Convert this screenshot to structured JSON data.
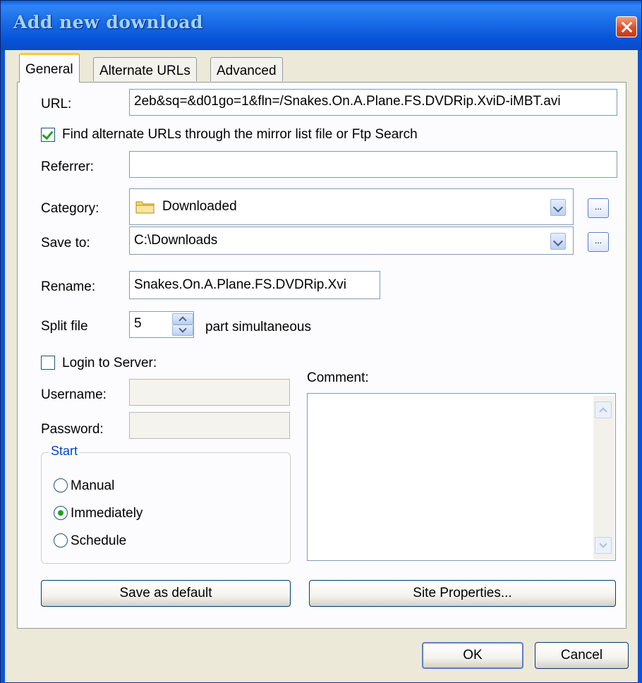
{
  "window": {
    "title": "Add new download"
  },
  "tabs": [
    {
      "label": "General"
    },
    {
      "label": "Alternate URLs"
    },
    {
      "label": "Advanced"
    }
  ],
  "url": {
    "label": "URL:",
    "value": "2eb&sq=&d01go=1&fln=/Snakes.On.A.Plane.FS.DVDRip.XviD-iMBT.avi"
  },
  "find_alternate": {
    "label": "Find alternate URLs through the mirror list file or Ftp Search",
    "checked": true
  },
  "referrer": {
    "label": "Referrer:",
    "value": ""
  },
  "category": {
    "label": "Category:",
    "value": "Downloaded",
    "icon": "folder-icon",
    "browse_label": "..."
  },
  "save_to": {
    "label": "Save to:",
    "value": "C:\\Downloads",
    "browse_label": "..."
  },
  "rename": {
    "label": "Rename:",
    "value": "Snakes.On.A.Plane.FS.DVDRip.Xvi"
  },
  "split": {
    "label": "Split file",
    "value": "5",
    "suffix": "part simultaneous"
  },
  "login": {
    "label": "Login to Server:",
    "checked": false
  },
  "username": {
    "label": "Username:",
    "value": ""
  },
  "password": {
    "label": "Password:",
    "value": ""
  },
  "comment": {
    "label": "Comment:",
    "value": ""
  },
  "start": {
    "title": "Start",
    "options": [
      {
        "label": "Manual",
        "selected": false
      },
      {
        "label": "Immediately",
        "selected": true
      },
      {
        "label": "Schedule",
        "selected": false
      }
    ]
  },
  "buttons": {
    "save_default": "Save as default",
    "site_properties": "Site Properties...",
    "ok": "OK",
    "cancel": "Cancel"
  },
  "colors": {
    "titlebar": "#0553d7",
    "accent_check": "#21a121",
    "tab_highlight": "#ffc83c"
  }
}
